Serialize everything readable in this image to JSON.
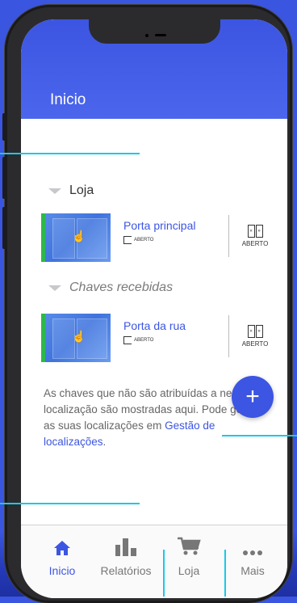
{
  "header": {
    "title": "Inicio"
  },
  "sections": [
    {
      "title": "Loja",
      "italic": false,
      "doors": [
        {
          "name": "Porta principal",
          "status": "ABERTO",
          "action_label": "ABERTO"
        }
      ]
    },
    {
      "title": "Chaves recebidas",
      "italic": true,
      "doors": [
        {
          "name": "Porta da rua",
          "status": "ABERTO",
          "action_label": "ABERTO"
        }
      ]
    }
  ],
  "info": {
    "text": "As chaves que não são atribuídas a nenhuma localização são mostradas aqui. Pode gerir as suas localizações em ",
    "link": "Gestão de localizações",
    "suffix": "."
  },
  "fab": {
    "label": "+"
  },
  "tabs": [
    {
      "label": "Inicio",
      "icon": "home-icon",
      "active": true
    },
    {
      "label": "Relatórios",
      "icon": "bar-chart-icon",
      "active": false
    },
    {
      "label": "Loja",
      "icon": "cart-icon",
      "active": false
    },
    {
      "label": "Mais",
      "icon": "more-icon",
      "active": false
    }
  ],
  "colors": {
    "primary": "#3c55e2",
    "status_green": "#2db84b",
    "annotation": "#19c9e6"
  }
}
